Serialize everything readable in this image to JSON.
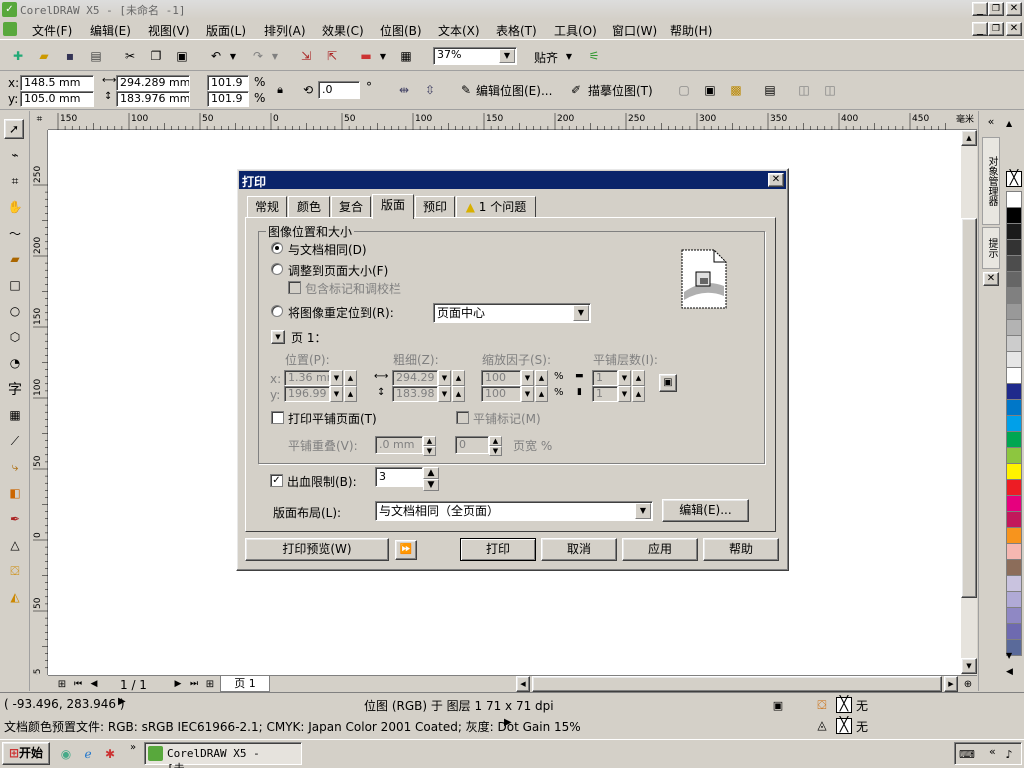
{
  "app": {
    "title": "CorelDRAW X5 - [未命名 -1]",
    "menu": [
      "文件(F)",
      "编辑(E)",
      "视图(V)",
      "版面(L)",
      "排列(A)",
      "效果(C)",
      "位图(B)",
      "文本(X)",
      "表格(T)",
      "工具(O)",
      "窗口(W)",
      "帮助(H)"
    ]
  },
  "toolbar": {
    "zoom": "37%",
    "snap": "贴齐"
  },
  "propbar": {
    "x": "148.5 mm",
    "y": "105.0 mm",
    "w": "294.289 mm",
    "h": "183.976 mm",
    "sx": "101.9",
    "sy": "101.9",
    "pct": "%",
    "angle": ".0",
    "deg": "°",
    "edit_bitmap": "编辑位图(E)...",
    "trace_bitmap": "描摹位图(T)"
  },
  "ruler": {
    "h_ticks": [
      "150",
      "100",
      "50",
      "0",
      "50",
      "100",
      "150",
      "200",
      "250",
      "300",
      "350",
      "400",
      "450"
    ],
    "h_unit": "毫米",
    "v_ticks": [
      "250",
      "200",
      "150",
      "100",
      "50",
      "0",
      "50",
      "95"
    ]
  },
  "dialog": {
    "title": "打印",
    "tabs": [
      "常规",
      "颜色",
      "复合",
      "版面",
      "预印",
      "1 个问题"
    ],
    "group_title": "图像位置和大小",
    "opt_same": "与文档相同(D)",
    "opt_fit": "调整到页面大小(F)",
    "opt_include_marks": "包含标记和调校栏",
    "opt_reposition": "将图像重定位到(R):",
    "reposition_value": "页面中心",
    "page_label": "页 1：",
    "col_position": "位置(P):",
    "col_thickness": "粗细(Z):",
    "col_scale": "缩放因子(S):",
    "col_tile_layers": "平铺层数(I):",
    "x_label": "x:",
    "y_label": "y:",
    "pos_x": "1.36 mm",
    "pos_y": "196.99 m",
    "size_w": "294.29 m",
    "size_h": "183.98 m",
    "scale_x": "100",
    "scale_y": "100",
    "tile_x": "1",
    "tile_y": "1",
    "pct": "%",
    "print_tiled": "打印平铺页面(T)",
    "tile_marks": "平铺标记(M)",
    "tile_overlap": "平铺重叠(V):",
    "overlap_value": ".0 mm",
    "overlap_pages": "0",
    "page_width": "页宽 %",
    "bleed_limit": "出血限制(B):",
    "bleed_value": "3",
    "layout_label": "版面布局(L):",
    "layout_value": "与文档相同（全页面）",
    "edit_btn": "编辑(E)...",
    "preview_btn": "打印预览(W)",
    "print_btn": "打印",
    "cancel_btn": "取消",
    "apply_btn": "应用",
    "help_btn": "帮助"
  },
  "docker": {
    "object_manager": "对象管理器",
    "hints": "提示"
  },
  "page_nav": {
    "count": "1 / 1",
    "tab": "页 1"
  },
  "status": {
    "coords": "( -93.496, 283.946 )",
    "info": "位图 (RGB) 于 图层 1 71 x 71 dpi",
    "fill_none": "无",
    "outline_none": "无",
    "color_profile": "文档颜色预置文件: RGB: sRGB IEC61966-2.1; CMYK: Japan Color 2001 Coated; 灰度: Dot Gain 15%"
  },
  "taskbar": {
    "start": "开始",
    "task": "CorelDRAW X5 - [未..."
  },
  "palette": [
    "#ffffff",
    "#000000",
    "#1a1a1a",
    "#333333",
    "#4d4d4d",
    "#666666",
    "#808080",
    "#999999",
    "#b3b3b3",
    "#cccccc",
    "#e6e6e6",
    "#ffffff",
    "#1f2a8c",
    "#0077c8",
    "#00a0e9",
    "#00a651",
    "#8dc63f",
    "#fff200",
    "#ed1c24",
    "#e6007e",
    "#c2185b",
    "#f7941d",
    "#f5b7b1",
    "#8c6d5a",
    "#c9c3df",
    "#b0aad6",
    "#8f88c4",
    "#6e6ab0",
    "#5a6a9a"
  ]
}
